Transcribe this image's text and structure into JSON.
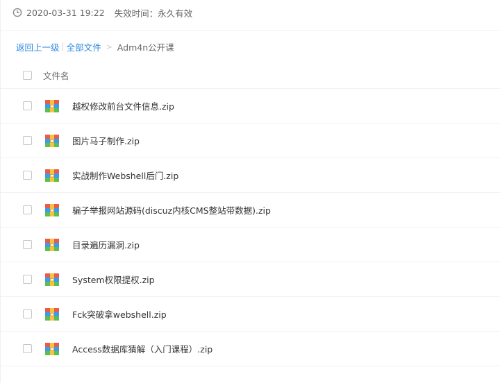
{
  "share_info": {
    "date": "2020-03-31 19:22",
    "expire_text": "失效时间：永久有效"
  },
  "breadcrumb": {
    "back_label": "返回上一级",
    "separator": "|",
    "all_files_label": "全部文件",
    "arrow": ">",
    "current_folder": "Adm4n公开课"
  },
  "list_header": {
    "name_column": "文件名"
  },
  "files": [
    {
      "name": "越权修改前台文件信息.zip",
      "icon": "zip-archive-icon"
    },
    {
      "name": "图片马子制作.zip",
      "icon": "zip-archive-icon"
    },
    {
      "name": "实战制作Webshell后门.zip",
      "icon": "zip-archive-icon"
    },
    {
      "name": "骗子举报网站源码(discuz内核CMS整站带数据).zip",
      "icon": "zip-archive-icon"
    },
    {
      "name": "目录遍历漏洞.zip",
      "icon": "zip-archive-icon"
    },
    {
      "name": "System权限提权.zip",
      "icon": "zip-archive-icon"
    },
    {
      "name": "Fck突破拿webshell.zip",
      "icon": "zip-archive-icon"
    },
    {
      "name": "Access数据库猜解（入门课程）.zip",
      "icon": "zip-archive-icon"
    }
  ],
  "colors": {
    "link": "#2b88e0",
    "text": "#333333",
    "muted": "#666666",
    "divider": "#f2f2f2"
  }
}
